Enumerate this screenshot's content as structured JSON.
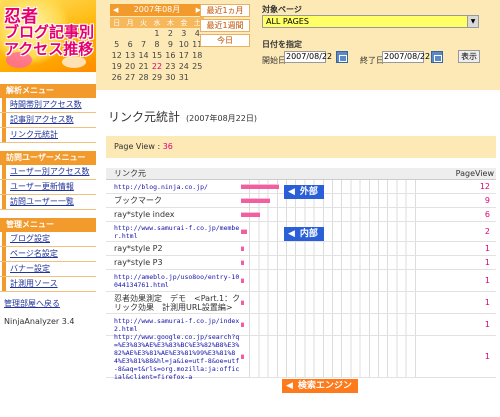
{
  "logo": {
    "line1": "忍者",
    "line2": "ブログ記事別",
    "line3": "アクセス推移"
  },
  "sidebar": {
    "analysis_menu": {
      "title": "解析メニュー",
      "items": [
        "時間帯別アクセス数",
        "記事別アクセス数",
        "リンク元統計"
      ]
    },
    "visitor_menu": {
      "title": "訪問ユーザーメニュー",
      "items": [
        "ユーザー別アクセス数",
        "ユーザー更新情報",
        "訪問ユーザー一覧"
      ]
    },
    "admin_menu": {
      "title": "管理メニュー",
      "items": [
        "ブログ設定",
        "ページ名設定",
        "バナー設定",
        "計測用ソース"
      ]
    },
    "back_link": "管理部屋へ戻る",
    "version": "NinjaAnalyzer 3.4"
  },
  "calendar": {
    "title": "2007年08月",
    "prev": "◀",
    "next": "▶",
    "weekdays": [
      "日",
      "月",
      "火",
      "水",
      "木",
      "金",
      "土"
    ],
    "weeks": [
      [
        "",
        "",
        "",
        "1",
        "2",
        "3",
        "4"
      ],
      [
        "5",
        "6",
        "7",
        "8",
        "9",
        "10",
        "11"
      ],
      [
        "12",
        "13",
        "14",
        "15",
        "16",
        "17",
        "18"
      ],
      [
        "19",
        "20",
        "21",
        "22",
        "23",
        "24",
        "25"
      ],
      [
        "26",
        "27",
        "28",
        "29",
        "30",
        "31",
        ""
      ]
    ],
    "highlight": "22"
  },
  "quick": {
    "month": "最近1ヵ月",
    "week": "最近1週間",
    "today": "今日"
  },
  "filter": {
    "target_label": "対象ページ",
    "target_value": "ALL PAGES",
    "date_label": "日付を指定",
    "start_label": "開始日",
    "start_value": "2007/08/22",
    "end_label": "終了日",
    "end_value": "2007/08/22",
    "show_button": "表示"
  },
  "page": {
    "title": "リンク元統計",
    "date": "(2007年08月22日)",
    "pv_label": "Page View :",
    "pv_value": "36"
  },
  "table": {
    "col_source": "リンク元",
    "col_pv": "PageView",
    "rows": [
      {
        "source": "http://blog.ninja.co.jp/",
        "url": true,
        "pv": 12
      },
      {
        "source": "ブックマーク",
        "url": false,
        "pv": 9
      },
      {
        "source": "ray*style index",
        "url": false,
        "pv": 6
      },
      {
        "source": "http://www.samurai-f.co.jp/member.html",
        "url": true,
        "pv": 2
      },
      {
        "source": "ray*style P2",
        "url": false,
        "pv": 1
      },
      {
        "source": "ray*style P3",
        "url": false,
        "pv": 1
      },
      {
        "source": "http://ameblo.jp/uso8oo/entry-10044134761.html",
        "url": true,
        "pv": 1
      },
      {
        "source": "忍者効果測定　デモ　<Part.1：クリック効果　計測用URL設置編>",
        "url": false,
        "pv": 1
      },
      {
        "source": "http://www.samurai-f.co.jp/index2.html",
        "url": true,
        "pv": 1
      },
      {
        "source": "http://www.google.co.jp/search?q=%E3%83%AE%E3%83%BC%E3%82%B8%E3%82%AE%E3%81%AE%E3%81%99%E3%81%84%E3%81%88&hl=ja&ie=utf-8&oe=utf-8&aq=t&rls=org.mozilla:ja:official&client=firefox-a",
        "url": true,
        "pv": 1
      }
    ],
    "max_pv": 12
  },
  "callouts": {
    "external": "外部",
    "internal": "内部",
    "search": "検索エンジン"
  },
  "colors": {
    "accent": "#f39a2d",
    "bar": "#f060a0",
    "callout_blue": "#2b5fd8",
    "callout_orange": "#ff7a1a"
  }
}
